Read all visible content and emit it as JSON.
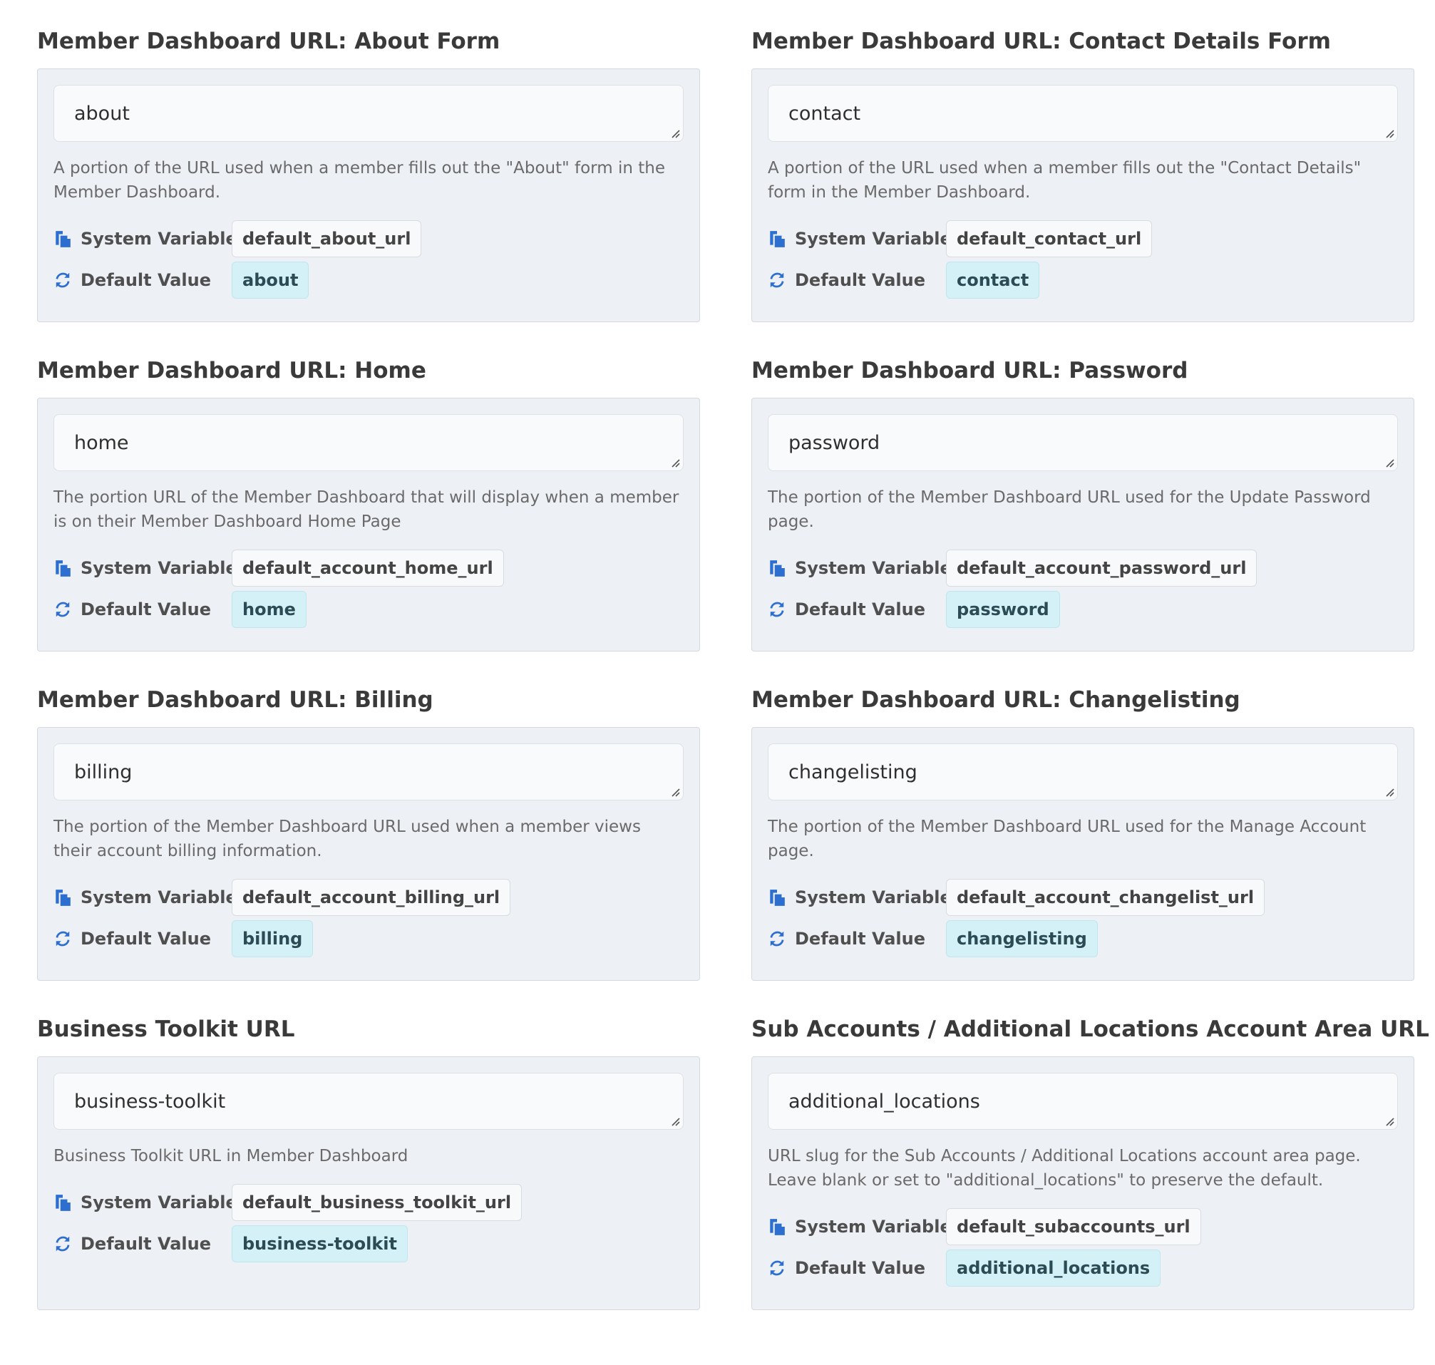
{
  "labels": {
    "system_variable": "System Variable",
    "default_value": "Default Value"
  },
  "colors": {
    "icon_blue": "#2d6fd1",
    "card_bg": "#edf0f5",
    "default_pill_bg": "#d3f1f7"
  },
  "icons": {
    "system_variable": "copy-icon",
    "default_value": "sync-icon"
  },
  "settings": [
    {
      "title": "Member Dashboard URL: About Form",
      "value": "about",
      "help": "A portion of the URL used when a member fills out the \"About\" form in the Member Dashboard.",
      "system_variable": "default_about_url",
      "default_value": "about"
    },
    {
      "title": "Member Dashboard URL: Contact Details Form",
      "value": "contact",
      "help": "A portion of the URL used when a member fills out the \"Contact Details\" form in the Member Dashboard.",
      "system_variable": "default_contact_url",
      "default_value": "contact"
    },
    {
      "title": "Member Dashboard URL: Home",
      "value": "home",
      "help": "The portion URL of the Member Dashboard that will display when a member is on their Member Dashboard Home Page",
      "system_variable": "default_account_home_url",
      "default_value": "home"
    },
    {
      "title": "Member Dashboard URL: Password",
      "value": "password",
      "help": "The portion of the Member Dashboard URL used for the Update Password page.",
      "system_variable": "default_account_password_url",
      "default_value": "password"
    },
    {
      "title": "Member Dashboard URL: Billing",
      "value": "billing",
      "help": "The portion of the Member Dashboard URL used when a member views their account billing information.",
      "system_variable": "default_account_billing_url",
      "default_value": "billing"
    },
    {
      "title": "Member Dashboard URL: Changelisting",
      "value": "changelisting",
      "help": "The portion of the Member Dashboard URL used for the Manage Account page.",
      "system_variable": "default_account_changelist_url",
      "default_value": "changelisting"
    },
    {
      "title": "Business Toolkit URL",
      "value": "business-toolkit",
      "help": "Business Toolkit URL in Member Dashboard",
      "system_variable": "default_business_toolkit_url",
      "default_value": "business-toolkit"
    },
    {
      "title": "Sub Accounts / Additional Locations Account Area URL Slug",
      "value": "additional_locations",
      "help": "URL slug for the Sub Accounts / Additional Locations account area page. Leave blank or set to \"additional_locations\" to preserve the default.",
      "system_variable": "default_subaccounts_url",
      "default_value": "additional_locations"
    }
  ]
}
